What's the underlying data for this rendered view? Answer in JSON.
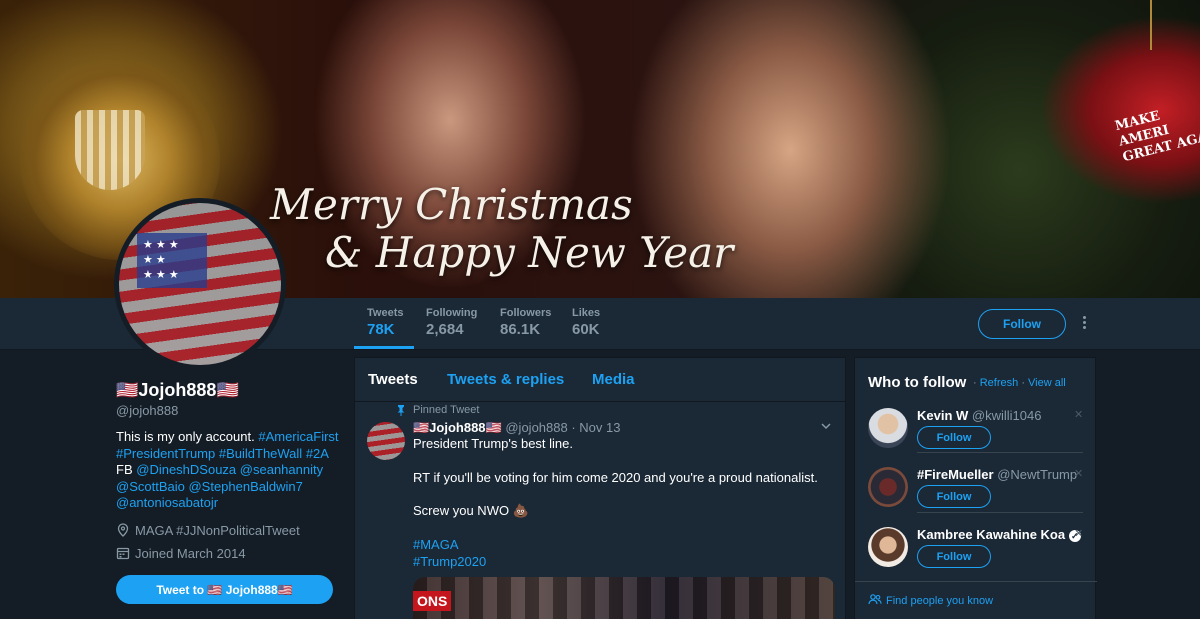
{
  "banner": {
    "line1": "Merry Christmas",
    "line2": "& Happy New Year",
    "hat_text": "MAKE AMERI GREAT AGA"
  },
  "profile": {
    "name": "🇺🇸Jojoh888🇺🇸",
    "handle": "@jojoh888",
    "bio_prefix": "This is my only account.",
    "bio_links": [
      "#AmericaFirst",
      "#PresidentTrump",
      "#BuildTheWall",
      "#2A"
    ],
    "bio_fb": "FB",
    "bio_mentions": [
      "@DineshDSouza",
      "@seanhannity",
      "@ScottBaio",
      "@StephenBaldwin7",
      "@antoniosabatojr"
    ],
    "location": "MAGA #JJNonPoliticalTweet",
    "joined": "Joined March 2014",
    "tweet_to_label": "Tweet to 🇺🇸 Jojoh888🇺🇸"
  },
  "stats": [
    {
      "label": "Tweets",
      "value": "78K"
    },
    {
      "label": "Following",
      "value": "2,684"
    },
    {
      "label": "Followers",
      "value": "86.1K"
    },
    {
      "label": "Likes",
      "value": "60K"
    }
  ],
  "actions": {
    "follow_label": "Follow"
  },
  "timeline": {
    "tabs": [
      "Tweets",
      "Tweets & replies",
      "Media"
    ],
    "pinned_label": "Pinned Tweet",
    "tweet": {
      "name": "🇺🇸Jojoh888🇺🇸",
      "handle": "@jojoh888",
      "date": "· Nov 13",
      "line1": "President Trump's best line.",
      "line2": "RT if you'll be voting for him come 2020 and you're a proud nationalist.",
      "line3": "Screw you NWO 💩",
      "hashtag1": "#MAGA",
      "hashtag2": "#Trump2020",
      "media_label": "ONS"
    }
  },
  "who_to_follow": {
    "title": "Who to follow",
    "refresh": "Refresh",
    "view_all": "View all",
    "suggestions": [
      {
        "name": "Kevin W",
        "handle": "@kwilli1046",
        "button": "Follow"
      },
      {
        "name": "#FireMueller",
        "handle": "@NewtTrump",
        "button": "Follow"
      },
      {
        "name": "Kambree Kawahine Koa",
        "handle": "",
        "button": "Follow"
      }
    ],
    "find_people": "Find people you know"
  },
  "colors": {
    "background": "#141d26",
    "panel": "#1b2836",
    "accent": "#1da1f2",
    "muted": "#8899a6"
  }
}
